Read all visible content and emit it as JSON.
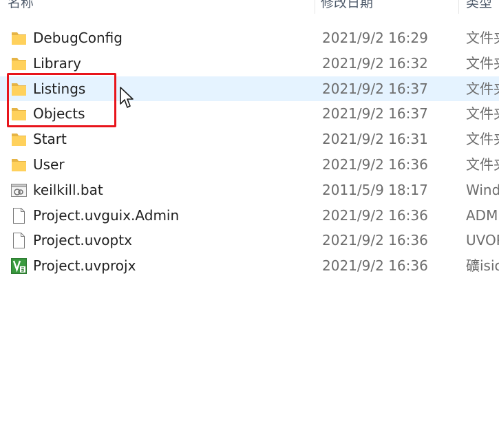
{
  "columns": {
    "name": "名称",
    "date": "修改日期",
    "type": "类型"
  },
  "files": [
    {
      "name": "DebugConfig",
      "date": "2021/9/2 16:29",
      "type": "文件夹",
      "icon": "folder-icon"
    },
    {
      "name": "Library",
      "date": "2021/9/2 16:32",
      "type": "文件夹",
      "icon": "folder-icon"
    },
    {
      "name": "Listings",
      "date": "2021/9/2 16:37",
      "type": "文件夹",
      "icon": "folder-icon"
    },
    {
      "name": "Objects",
      "date": "2021/9/2 16:37",
      "type": "文件夹",
      "icon": "folder-icon"
    },
    {
      "name": "Start",
      "date": "2021/9/2 16:31",
      "type": "文件夹",
      "icon": "folder-icon"
    },
    {
      "name": "User",
      "date": "2021/9/2 16:36",
      "type": "文件夹",
      "icon": "folder-icon"
    },
    {
      "name": "keilkill.bat",
      "date": "2011/5/9 18:17",
      "type": "Windows",
      "icon": "batch-file-icon"
    },
    {
      "name": "Project.uvguix.Admin",
      "date": "2021/9/2 16:36",
      "type": "ADMIN",
      "icon": "file-icon"
    },
    {
      "name": "Project.uvoptx",
      "date": "2021/9/2 16:36",
      "type": "UVOPTX",
      "icon": "file-icon"
    },
    {
      "name": "Project.uvprojx",
      "date": "2021/9/2 16:36",
      "type": "礦isio",
      "icon": "keil-project-icon"
    }
  ],
  "colors": {
    "hover_row": "#e5f3ff",
    "highlight_box": "#e8141b",
    "folder": "#ffd15c"
  }
}
